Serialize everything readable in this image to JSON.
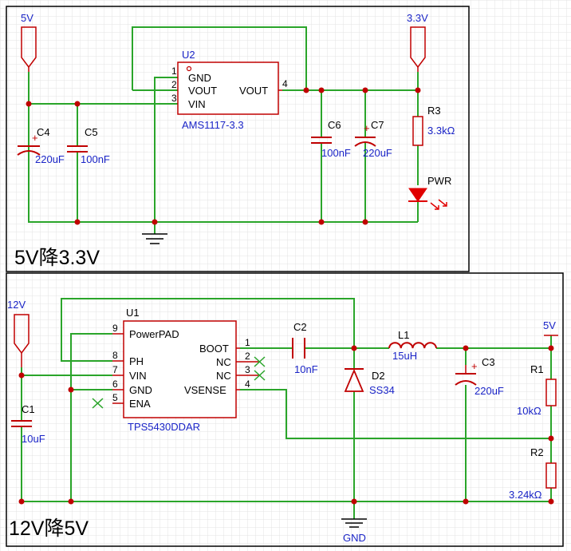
{
  "colors": {
    "wire": "#2aa52a",
    "component": "#c00000",
    "label": "#1a24c7",
    "text": "#000000",
    "grid": "#e3e3e3",
    "led": "#e00000"
  },
  "top": {
    "title": "5V降3.3V",
    "net_5v": "5V",
    "net_3v3": "3.3V",
    "u2_ref": "U2",
    "u2_part": "AMS1117-3.3",
    "u2_pin1_num": "1",
    "u2_pin1_name": "GND",
    "u2_pin2_num": "2",
    "u2_pin2_name": "VOUT",
    "u2_pin3_num": "3",
    "u2_pin3_name": "VIN",
    "u2_pin4_num": "4",
    "u2_pin4_name": "VOUT",
    "c4_ref": "C4",
    "c4_val": "220uF",
    "c5_ref": "C5",
    "c5_val": "100nF",
    "c6_ref": "C6",
    "c6_val": "100nF",
    "c7_ref": "C7",
    "c7_val": "220uF",
    "r3_ref": "R3",
    "r3_val": "3.3kΩ",
    "led_ref": "PWR"
  },
  "bottom": {
    "title": "12V降5V",
    "net_12v": "12V",
    "net_5v": "5V",
    "net_gnd": "GND",
    "u1_ref": "U1",
    "u1_part": "TPS5430DDAR",
    "u1_pin9_num": "9",
    "u1_pin9_name": "PowerPAD",
    "u1_pin8_num": "8",
    "u1_pin8_name": "PH",
    "u1_pin7_num": "7",
    "u1_pin7_name": "VIN",
    "u1_pin6_num": "6",
    "u1_pin6_name": "GND",
    "u1_pin5_num": "5",
    "u1_pin5_name": "ENA",
    "u1_pin1_num": "1",
    "u1_pin1_name": "BOOT",
    "u1_pin2_num": "2",
    "u1_pin2_name": "NC",
    "u1_pin3_num": "3",
    "u1_pin3_name": "NC",
    "u1_pin4_num": "4",
    "u1_pin4_name": "VSENSE",
    "c1_ref": "C1",
    "c1_val": "10uF",
    "c2_ref": "C2",
    "c2_val": "10nF",
    "c3_ref": "C3",
    "c3_val": "220uF",
    "l1_ref": "L1",
    "l1_val": "15uH",
    "d2_ref": "D2",
    "d2_val": "SS34",
    "r1_ref": "R1",
    "r1_val": "10kΩ",
    "r2_ref": "R2",
    "r2_val": "3.24kΩ"
  }
}
